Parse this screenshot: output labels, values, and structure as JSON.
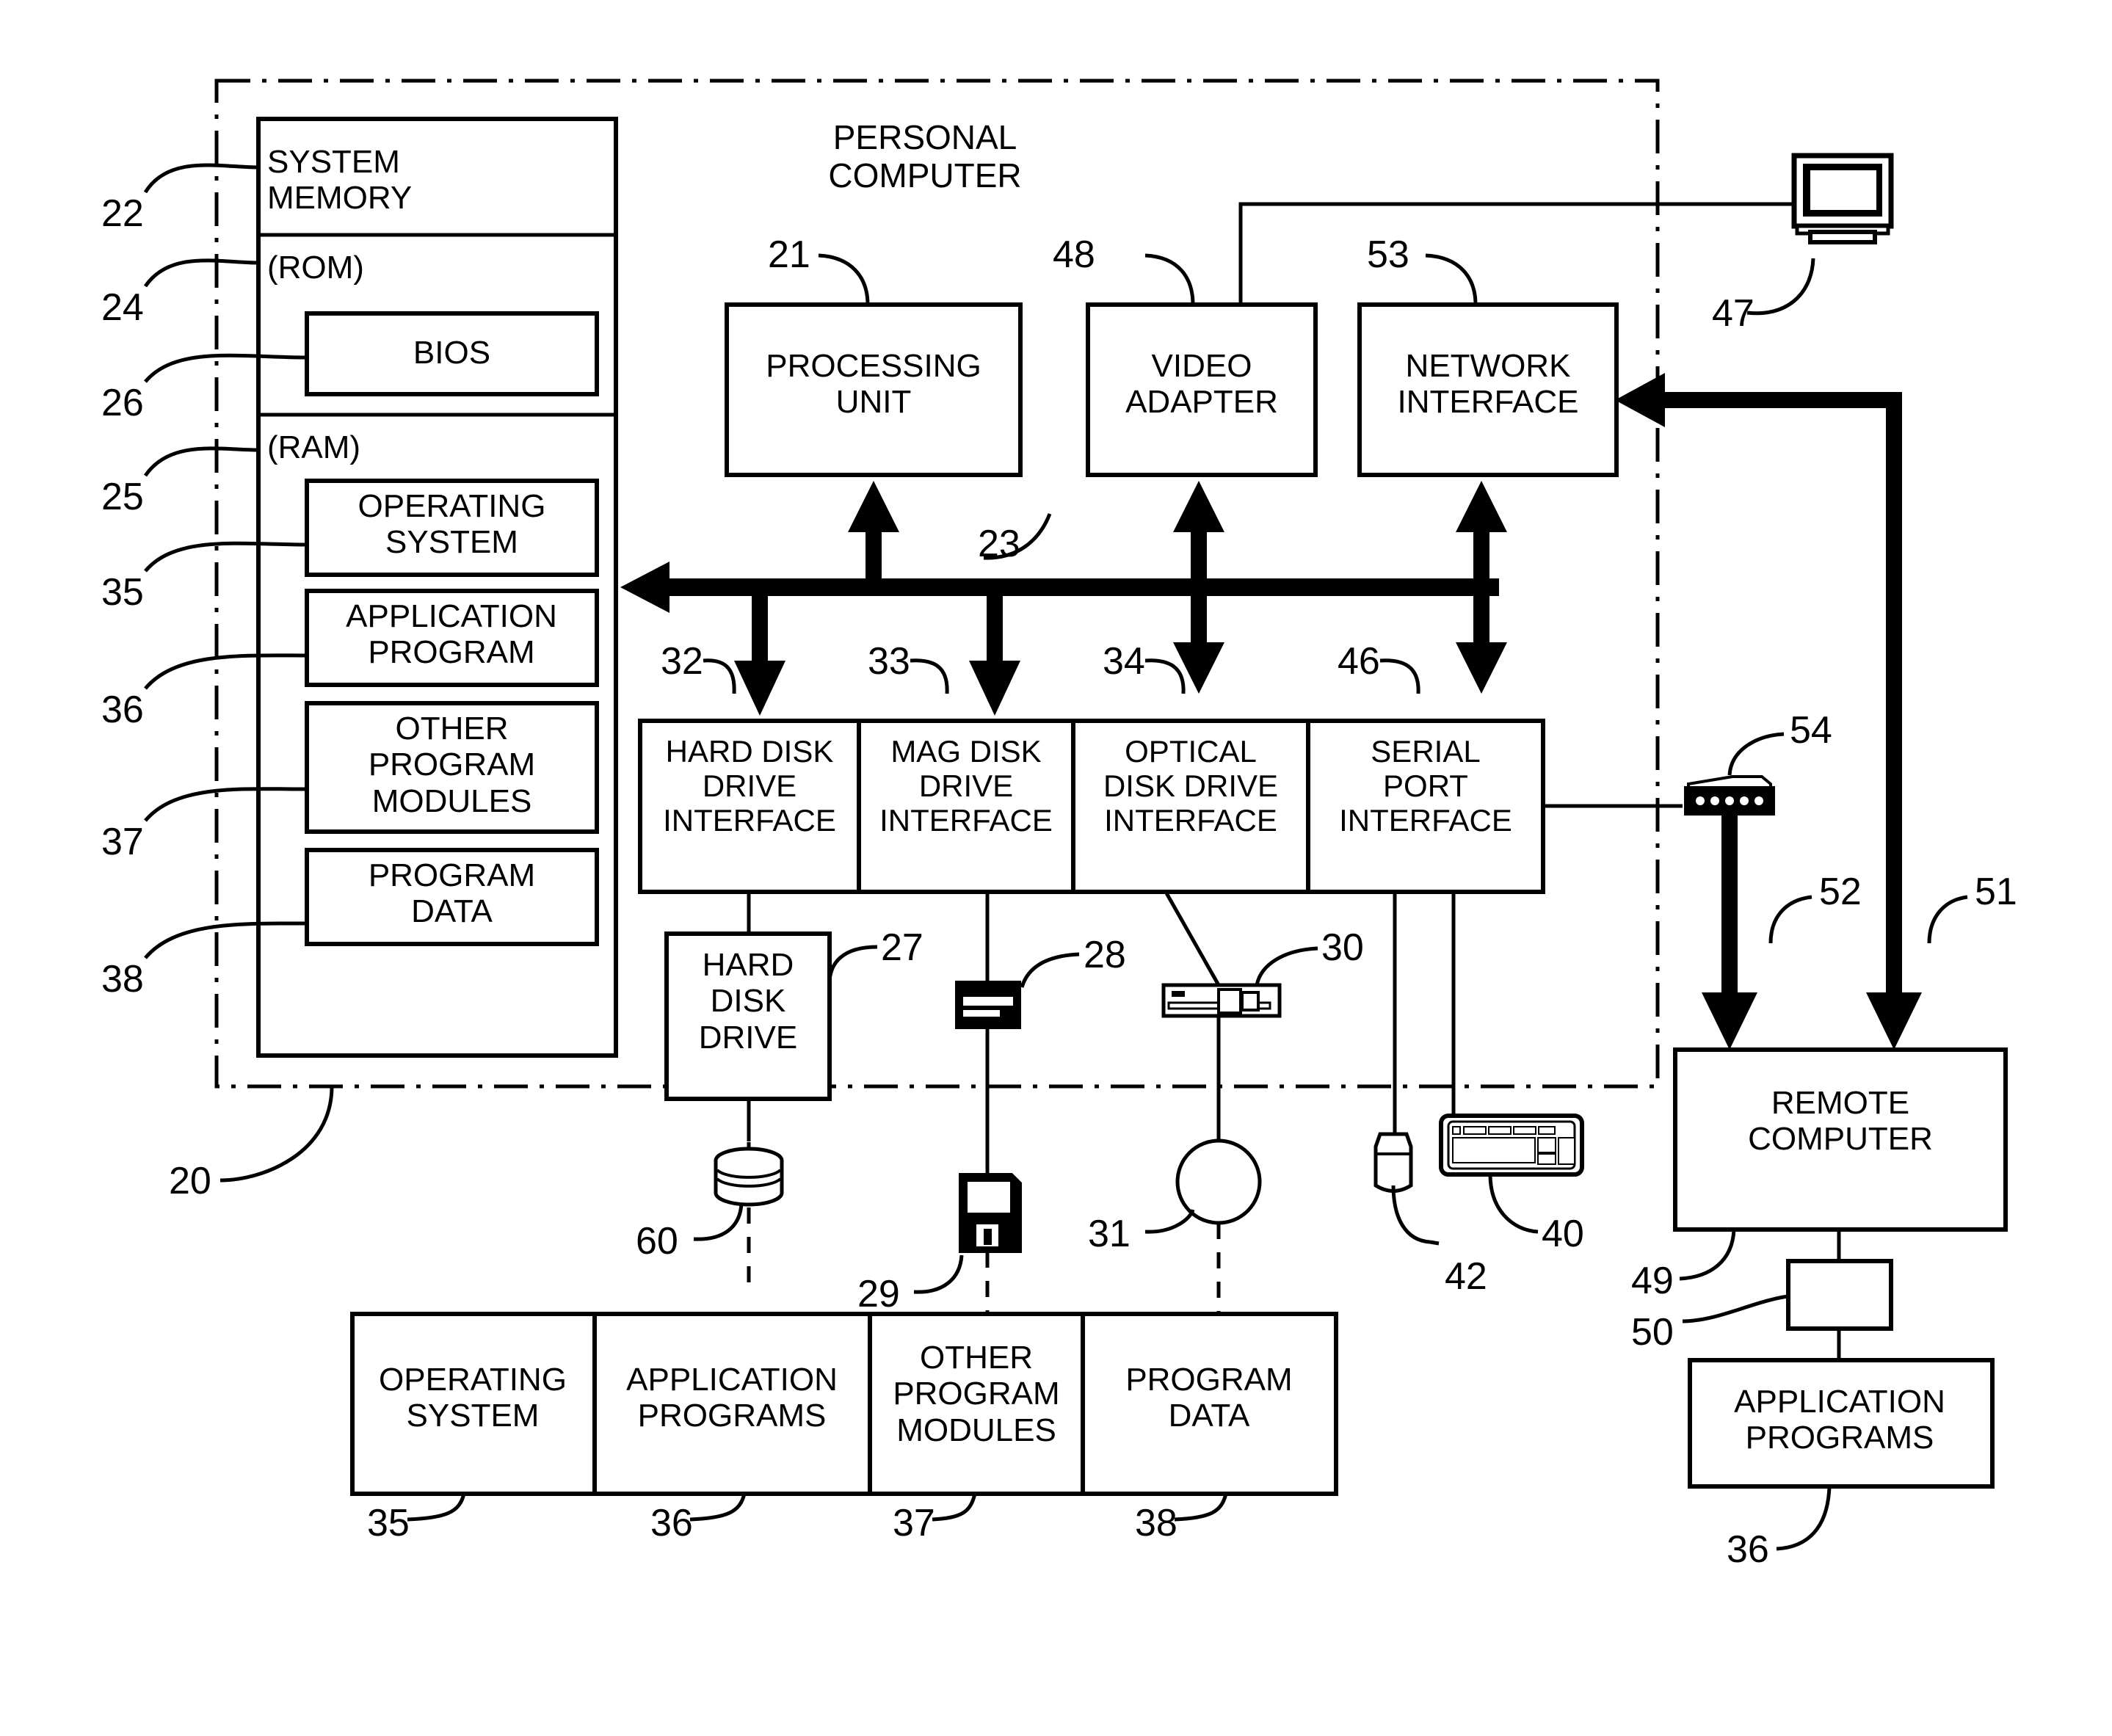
{
  "figure": {
    "title": "PERSONAL COMPUTER",
    "outer_boundary_style": "dash-dot"
  },
  "system_memory": {
    "header": "SYSTEM\nMEMORY",
    "rom_label": "(ROM)",
    "ram_label": "(RAM)",
    "blocks": [
      {
        "label": "BIOS",
        "ref": "26"
      },
      {
        "label": "OPERATING\nSYSTEM",
        "ref": "35"
      },
      {
        "label": "APPLICATION\nPROGRAM",
        "ref": "36"
      },
      {
        "label": "OTHER\nPROGRAM\nMODULES",
        "ref": "37"
      },
      {
        "label": "PROGRAM\nDATA",
        "ref": "38"
      }
    ]
  },
  "boxes": {
    "processing_unit": "PROCESSING\nUNIT",
    "video_adapter": "VIDEO\nADAPTER",
    "network_interface": "NETWORK\nINTERFACE",
    "hard_disk_drive_interface": "HARD DISK\nDRIVE\nINTERFACE",
    "mag_disk_drive_interface": "MAG DISK\nDRIVE\nINTERFACE",
    "optical_disk_drive_interface": "OPTICAL\nDISK DRIVE\nINTERFACE",
    "serial_port_interface": "SERIAL\nPORT\nINTERFACE",
    "hard_disk_drive": "HARD\nDISK\nDRIVE",
    "remote_computer": "REMOTE\nCOMPUTER",
    "remote_application_programs": "APPLICATION\nPROGRAMS"
  },
  "storage_row": [
    {
      "label": "OPERATING\nSYSTEM",
      "ref": "35"
    },
    {
      "label": "APPLICATION\nPROGRAMS",
      "ref": "36"
    },
    {
      "label": "OTHER\nPROGRAM\nMODULES",
      "ref": "37"
    },
    {
      "label": "PROGRAM\nDATA",
      "ref": "38"
    }
  ],
  "reference_numerals": {
    "system_memory": "22",
    "rom": "24",
    "bios": "26",
    "ram": "25",
    "operating_system": "35",
    "application_program": "36",
    "other_program_modules": "37",
    "program_data": "38",
    "computer": "20",
    "processing_unit": "21",
    "system_bus": "23",
    "video_adapter": "48",
    "network_interface": "53",
    "monitor": "47",
    "hard_disk_interface": "32",
    "mag_disk_interface": "33",
    "optical_disk_interface": "34",
    "serial_port_interface": "46",
    "hard_disk_drive": "27",
    "mag_disk_drive": "28",
    "optical_disk_drive": "30",
    "hard_disk": "60",
    "mag_disk": "29",
    "optical_disk": "31",
    "keyboard": "40",
    "mouse": "42",
    "modem": "54",
    "wan_link": "52",
    "lan_link": "51",
    "remote_computer": "49",
    "memory_storage_device": "50",
    "remote_application_programs": "36"
  },
  "icons": {
    "monitor": "monitor-icon",
    "hard_disk_platter": "hard-disk-platter-icon",
    "floppy_disk": "floppy-disk-icon",
    "optical_disc": "optical-disc-icon",
    "mag_disk_drive": "mag-disk-drive-icon",
    "optical_disk_drive": "optical-disk-drive-icon",
    "keyboard": "keyboard-icon",
    "mouse": "mouse-icon",
    "modem": "modem-icon"
  },
  "colors": {
    "ink": "#000000",
    "paper": "#ffffff"
  }
}
